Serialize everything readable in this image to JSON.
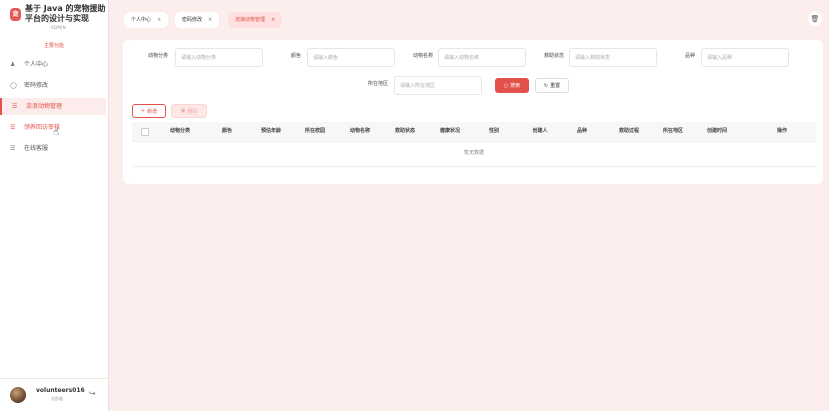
{
  "brand": {
    "logo_text": "宠",
    "title": "基于 Java 的宠物援助平台的设计与实现",
    "subtitle": "ADMIN"
  },
  "sidebar": {
    "group_title": "主要功能",
    "items": [
      {
        "label": "个人中心",
        "icon": "user-icon"
      },
      {
        "label": "密码修改",
        "icon": "shield-icon"
      },
      {
        "label": "流浪动物管理",
        "icon": "list-icon"
      },
      {
        "label": "领养回访审核",
        "icon": "list-icon"
      },
      {
        "label": "在线客服",
        "icon": "list-icon"
      }
    ]
  },
  "user": {
    "name": "volunteers016",
    "role": "志愿者"
  },
  "tabs": [
    {
      "label": "个人中心"
    },
    {
      "label": "密码修改"
    },
    {
      "label": "流浪动物管理"
    }
  ],
  "filters": {
    "category": {
      "label": "动物分类",
      "placeholder": "请输入动物分类"
    },
    "color": {
      "label": "颜色",
      "placeholder": "请输入颜色"
    },
    "name": {
      "label": "动物名称",
      "placeholder": "请输入动物名称"
    },
    "status": {
      "label": "救助状态",
      "placeholder": "请输入救助状态"
    },
    "breed": {
      "label": "品种",
      "placeholder": "请输入品种"
    },
    "region": {
      "label": "所在地区",
      "placeholder": "请输入所在地区"
    }
  },
  "buttons": {
    "search": "搜索",
    "reset": "重置",
    "add": "新增",
    "delete": "删除"
  },
  "table": {
    "columns": [
      "动物分类",
      "颜色",
      "预估年龄",
      "所在校园",
      "动物名称",
      "救助状态",
      "健康状况",
      "性别",
      "创建人",
      "品种",
      "救助过程",
      "所在地区",
      "创建时间",
      "操作"
    ],
    "empty_text": "暂无数据"
  },
  "colors": {
    "accent": "#e2524a",
    "background": "#fdeeee"
  }
}
